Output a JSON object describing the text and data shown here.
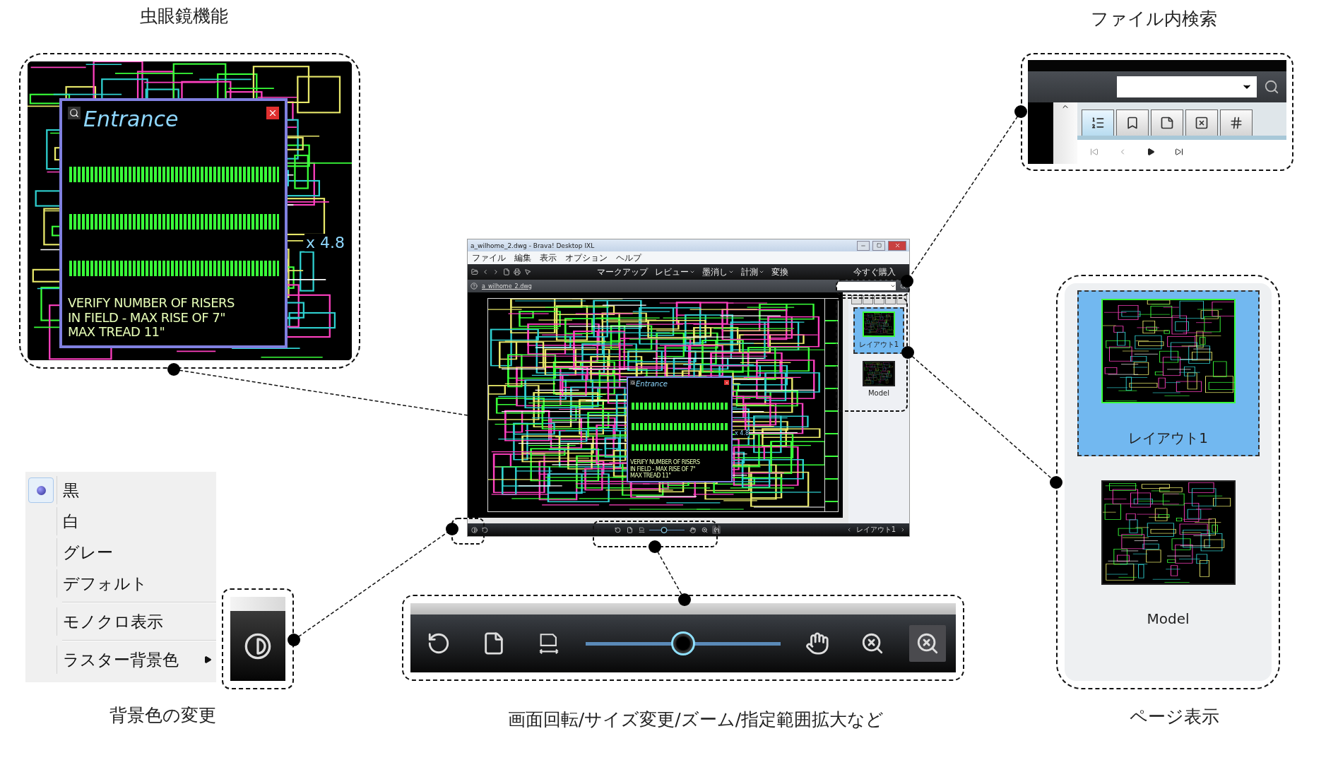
{
  "magnifier_callout": {
    "caption": "虫眼鏡機能",
    "label": "Entrance",
    "note": "VERIFY NUMBER OF RISERS\nIN FIELD - MAX RISE OF 7\"\nMAX TREAD 11\"",
    "scale": "x 4.8"
  },
  "search_callout": {
    "caption": "ファイル内検索",
    "tabs": [
      {
        "kind": "list",
        "selected": true
      },
      {
        "kind": "bookmark",
        "selected": false
      },
      {
        "kind": "note",
        "selected": false
      },
      {
        "kind": "redaction",
        "selected": false
      },
      {
        "kind": "number",
        "selected": false
      }
    ]
  },
  "app_window": {
    "title": "a_wilhome_2.dwg - Brava! Desktop IXL",
    "menu": [
      "ファイル",
      "編集",
      "表示",
      "オプション",
      "ヘルプ"
    ],
    "toolbar_menus": [
      {
        "label": "マークアップ",
        "has_dropdown": false
      },
      {
        "label": "レビュー",
        "has_dropdown": true
      },
      {
        "label": "墨消し",
        "has_dropdown": true
      },
      {
        "label": "計測",
        "has_dropdown": true
      },
      {
        "label": "変換",
        "has_dropdown": false
      }
    ],
    "buy_button": "今すぐ購入",
    "document_tab": "a_wilhome_2.dwg",
    "magnifier": {
      "label": "Entrance",
      "note": "VERIFY NUMBER OF RISERS\nIN FIELD - MAX RISE OF 7\"\nMAX TREAD 11\"",
      "scale": "x 4.8"
    },
    "thumbnails": [
      {
        "label": "レイアウト1",
        "selected": true
      },
      {
        "label": "Model",
        "selected": false
      }
    ],
    "zoom_slider": {
      "level": 0.4
    },
    "page_selector": "レイアウト1"
  },
  "pages_callout": {
    "caption": "ページ表示",
    "thumbnails": [
      {
        "label": "レイアウト1",
        "selected": true
      },
      {
        "label": "Model",
        "selected": false
      }
    ]
  },
  "background_callout": {
    "caption": "背景色の変更",
    "menu": [
      {
        "kind": "radio",
        "label": "黒",
        "selected": true
      },
      {
        "kind": "radio",
        "label": "白",
        "selected": false
      },
      {
        "kind": "radio",
        "label": "グレー",
        "selected": false
      },
      {
        "kind": "radio",
        "label": "デフォルト",
        "selected": false
      },
      {
        "kind": "separator"
      },
      {
        "kind": "command",
        "label": "モノクロ表示"
      },
      {
        "kind": "separator"
      },
      {
        "kind": "submenu",
        "label": "ラスター背景色"
      }
    ]
  },
  "view_toolbar_callout": {
    "caption": "画面回転/サイズ変更/ズーム/指定範囲拡大など",
    "left_tools": [
      {
        "kind": "rotate",
        "selected": false
      },
      {
        "kind": "page",
        "selected": false
      },
      {
        "kind": "fit_width",
        "selected": false
      }
    ],
    "zoom_slider": {
      "level": 0.5
    },
    "right_tools": [
      {
        "kind": "pan",
        "selected": false
      },
      {
        "kind": "zoom_area",
        "selected": false
      },
      {
        "kind": "zoom",
        "selected": true
      }
    ]
  }
}
